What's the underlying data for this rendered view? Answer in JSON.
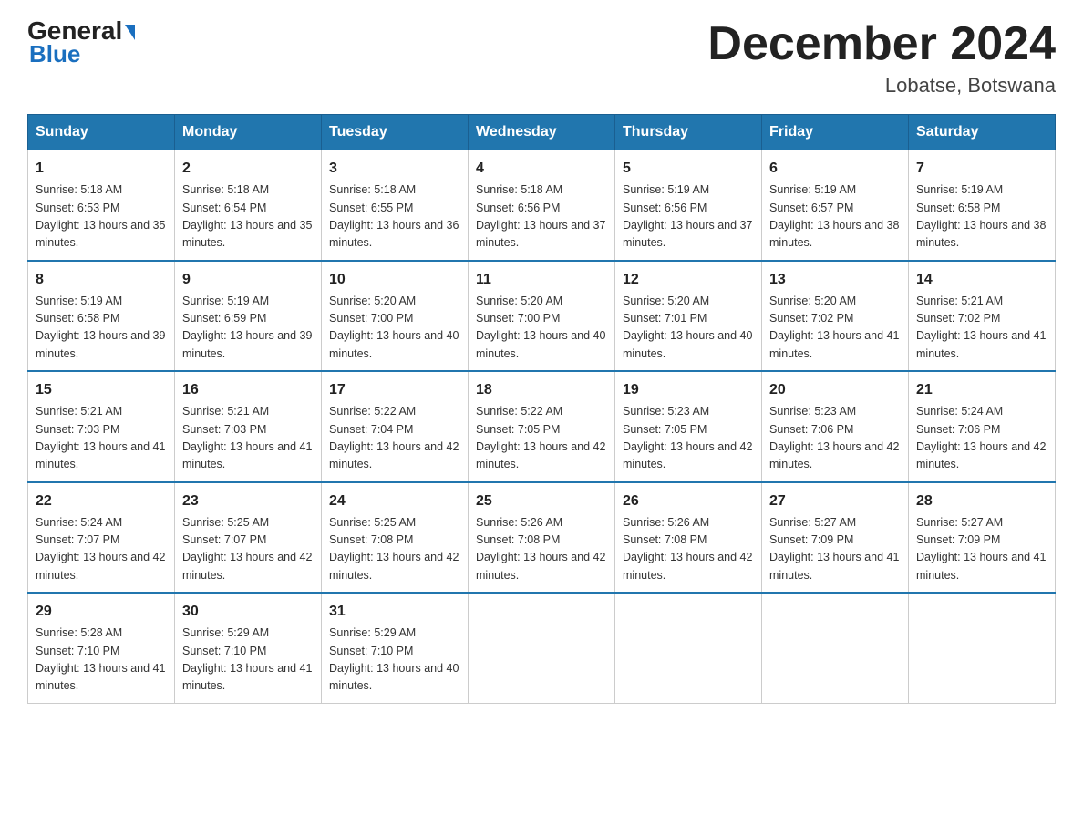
{
  "logo": {
    "general": "General",
    "arrow": "▶",
    "blue": "Blue"
  },
  "title": "December 2024",
  "subtitle": "Lobatse, Botswana",
  "weekdays": [
    "Sunday",
    "Monday",
    "Tuesday",
    "Wednesday",
    "Thursday",
    "Friday",
    "Saturday"
  ],
  "weeks": [
    [
      {
        "day": "1",
        "sunrise": "5:18 AM",
        "sunset": "6:53 PM",
        "daylight": "13 hours and 35 minutes."
      },
      {
        "day": "2",
        "sunrise": "5:18 AM",
        "sunset": "6:54 PM",
        "daylight": "13 hours and 35 minutes."
      },
      {
        "day": "3",
        "sunrise": "5:18 AM",
        "sunset": "6:55 PM",
        "daylight": "13 hours and 36 minutes."
      },
      {
        "day": "4",
        "sunrise": "5:18 AM",
        "sunset": "6:56 PM",
        "daylight": "13 hours and 37 minutes."
      },
      {
        "day": "5",
        "sunrise": "5:19 AM",
        "sunset": "6:56 PM",
        "daylight": "13 hours and 37 minutes."
      },
      {
        "day": "6",
        "sunrise": "5:19 AM",
        "sunset": "6:57 PM",
        "daylight": "13 hours and 38 minutes."
      },
      {
        "day": "7",
        "sunrise": "5:19 AM",
        "sunset": "6:58 PM",
        "daylight": "13 hours and 38 minutes."
      }
    ],
    [
      {
        "day": "8",
        "sunrise": "5:19 AM",
        "sunset": "6:58 PM",
        "daylight": "13 hours and 39 minutes."
      },
      {
        "day": "9",
        "sunrise": "5:19 AM",
        "sunset": "6:59 PM",
        "daylight": "13 hours and 39 minutes."
      },
      {
        "day": "10",
        "sunrise": "5:20 AM",
        "sunset": "7:00 PM",
        "daylight": "13 hours and 40 minutes."
      },
      {
        "day": "11",
        "sunrise": "5:20 AM",
        "sunset": "7:00 PM",
        "daylight": "13 hours and 40 minutes."
      },
      {
        "day": "12",
        "sunrise": "5:20 AM",
        "sunset": "7:01 PM",
        "daylight": "13 hours and 40 minutes."
      },
      {
        "day": "13",
        "sunrise": "5:20 AM",
        "sunset": "7:02 PM",
        "daylight": "13 hours and 41 minutes."
      },
      {
        "day": "14",
        "sunrise": "5:21 AM",
        "sunset": "7:02 PM",
        "daylight": "13 hours and 41 minutes."
      }
    ],
    [
      {
        "day": "15",
        "sunrise": "5:21 AM",
        "sunset": "7:03 PM",
        "daylight": "13 hours and 41 minutes."
      },
      {
        "day": "16",
        "sunrise": "5:21 AM",
        "sunset": "7:03 PM",
        "daylight": "13 hours and 41 minutes."
      },
      {
        "day": "17",
        "sunrise": "5:22 AM",
        "sunset": "7:04 PM",
        "daylight": "13 hours and 42 minutes."
      },
      {
        "day": "18",
        "sunrise": "5:22 AM",
        "sunset": "7:05 PM",
        "daylight": "13 hours and 42 minutes."
      },
      {
        "day": "19",
        "sunrise": "5:23 AM",
        "sunset": "7:05 PM",
        "daylight": "13 hours and 42 minutes."
      },
      {
        "day": "20",
        "sunrise": "5:23 AM",
        "sunset": "7:06 PM",
        "daylight": "13 hours and 42 minutes."
      },
      {
        "day": "21",
        "sunrise": "5:24 AM",
        "sunset": "7:06 PM",
        "daylight": "13 hours and 42 minutes."
      }
    ],
    [
      {
        "day": "22",
        "sunrise": "5:24 AM",
        "sunset": "7:07 PM",
        "daylight": "13 hours and 42 minutes."
      },
      {
        "day": "23",
        "sunrise": "5:25 AM",
        "sunset": "7:07 PM",
        "daylight": "13 hours and 42 minutes."
      },
      {
        "day": "24",
        "sunrise": "5:25 AM",
        "sunset": "7:08 PM",
        "daylight": "13 hours and 42 minutes."
      },
      {
        "day": "25",
        "sunrise": "5:26 AM",
        "sunset": "7:08 PM",
        "daylight": "13 hours and 42 minutes."
      },
      {
        "day": "26",
        "sunrise": "5:26 AM",
        "sunset": "7:08 PM",
        "daylight": "13 hours and 42 minutes."
      },
      {
        "day": "27",
        "sunrise": "5:27 AM",
        "sunset": "7:09 PM",
        "daylight": "13 hours and 41 minutes."
      },
      {
        "day": "28",
        "sunrise": "5:27 AM",
        "sunset": "7:09 PM",
        "daylight": "13 hours and 41 minutes."
      }
    ],
    [
      {
        "day": "29",
        "sunrise": "5:28 AM",
        "sunset": "7:10 PM",
        "daylight": "13 hours and 41 minutes."
      },
      {
        "day": "30",
        "sunrise": "5:29 AM",
        "sunset": "7:10 PM",
        "daylight": "13 hours and 41 minutes."
      },
      {
        "day": "31",
        "sunrise": "5:29 AM",
        "sunset": "7:10 PM",
        "daylight": "13 hours and 40 minutes."
      },
      null,
      null,
      null,
      null
    ]
  ]
}
